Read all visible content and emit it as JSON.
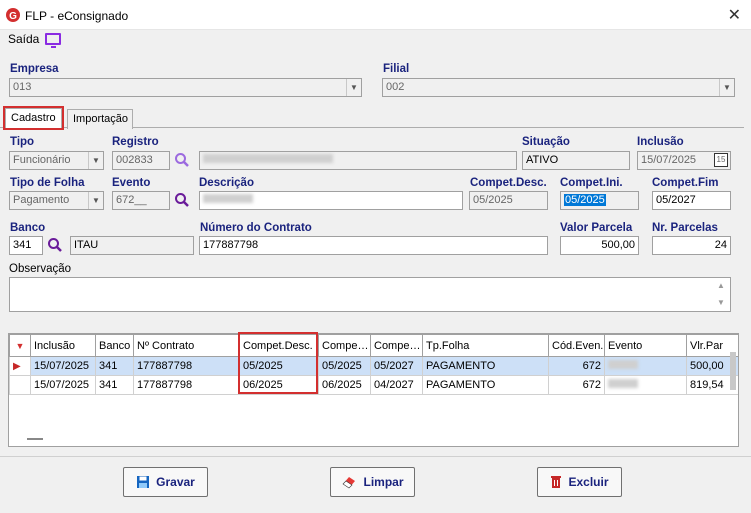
{
  "window": {
    "title": "FLP - eConsignado",
    "close": "✕"
  },
  "menu": {
    "saida": "Saída"
  },
  "empresa": {
    "label": "Empresa",
    "value": "013"
  },
  "filial": {
    "label": "Filial",
    "value": "002"
  },
  "tabs": [
    {
      "label": "Cadastro"
    },
    {
      "label": "Importação"
    }
  ],
  "form": {
    "tipo": {
      "label": "Tipo",
      "value": "Funcionário"
    },
    "registro": {
      "label": "Registro",
      "value": "002833"
    },
    "situacao": {
      "label": "Situação",
      "value": "ATIVO"
    },
    "inclusao": {
      "label": "Inclusão",
      "value": "15/07/2025"
    },
    "tipo_folha": {
      "label": "Tipo de Folha",
      "value": "Pagamento"
    },
    "evento": {
      "label": "Evento",
      "value": "672__"
    },
    "descricao": {
      "label": "Descrição",
      "value": ""
    },
    "compet_desc": {
      "label": "Compet.Desc.",
      "value": "05/2025"
    },
    "compet_ini": {
      "label": "Compet.Ini.",
      "value": "05/2025"
    },
    "compet_fim": {
      "label": "Compet.Fim",
      "value": "05/2027"
    },
    "banco": {
      "label": "Banco",
      "code": "341",
      "name": "ITAU"
    },
    "numero_contrato": {
      "label": "Número do Contrato",
      "value": "177887798"
    },
    "valor_parcela": {
      "label": "Valor Parcela",
      "value": "500,00"
    },
    "nr_parcelas": {
      "label": "Nr. Parcelas",
      "value": "24"
    },
    "observacao": {
      "label": "Observação",
      "value": ""
    }
  },
  "grid": {
    "headers": [
      "Inclusão",
      "Banco",
      "Nº Contrato",
      "Compet.Desc.",
      "Compe…",
      "Compe…",
      "Tp.Folha",
      "Cód.Even.",
      "Evento",
      "Vlr.Par"
    ],
    "rows": [
      [
        "15/07/2025",
        "341",
        "177887798",
        "05/2025",
        "05/2025",
        "05/2027",
        "PAGAMENTO",
        "672",
        "",
        "500,00"
      ],
      [
        "15/07/2025",
        "341",
        "177887798",
        "06/2025",
        "06/2025",
        "04/2027",
        "PAGAMENTO",
        "672",
        "",
        "819,54"
      ]
    ]
  },
  "buttons": {
    "gravar": "Gravar",
    "limpar": "Limpar",
    "excluir": "Excluir"
  },
  "colors": {
    "label": "#1a237e",
    "highlight": "#d32f2f",
    "accent": "#8a2be2"
  }
}
